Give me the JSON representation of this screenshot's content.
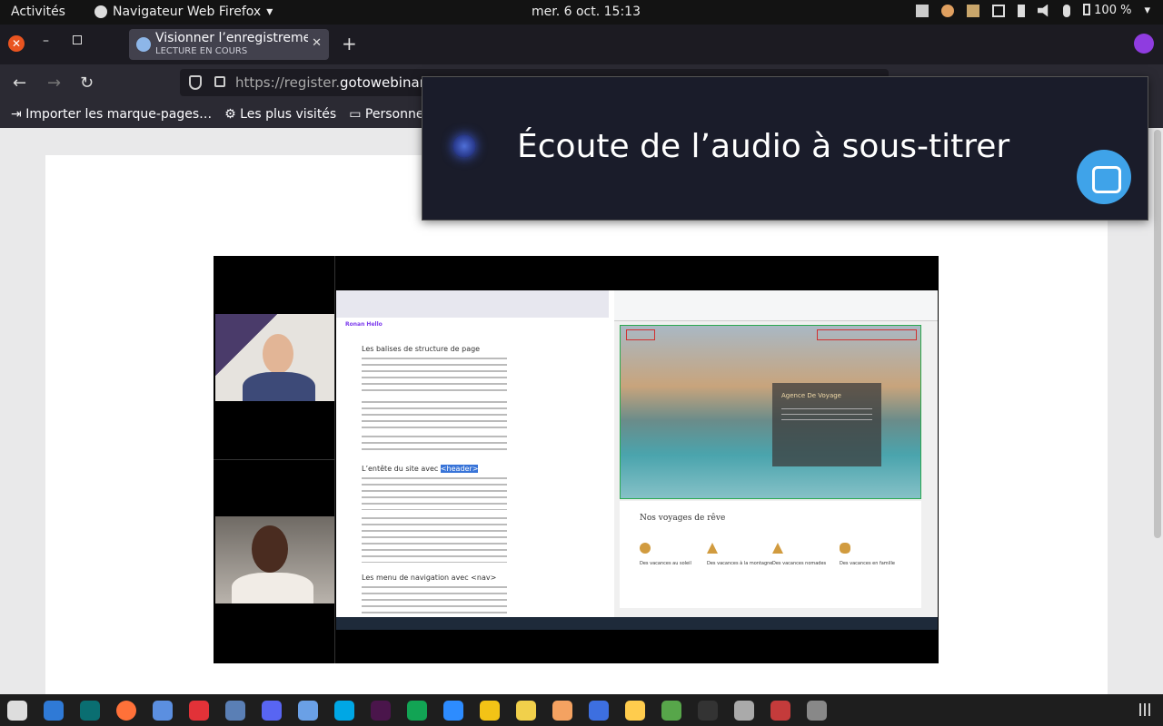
{
  "topbar": {
    "activities": "Activités",
    "app_name": "Navigateur Web Firefox",
    "clock": "mer. 6 oct.  15:13",
    "battery": "100 %"
  },
  "tab": {
    "title": "Visionner l’enregistremen",
    "subtitle": "LECTURE EN COURS"
  },
  "url": {
    "prefix": "https://register.",
    "domain": "gotowebinar."
  },
  "bookmarks": [
    "Importer les marque-pages…",
    "Les plus visités",
    "Personnel"
  ],
  "caption": {
    "text": "Écoute de l’audio à sous-titrer"
  },
  "shared": {
    "brand": "Ronan Hello",
    "h1": "Les balises de structure de page",
    "h2_prefix": "L’entête du site avec ",
    "h2_tag": "<header>",
    "h3": "Les menu de navigation avec <nav>",
    "card_title": "Agence De Voyage",
    "section_title": "Nos voyages de rêve",
    "categories": [
      "Des vacances au soleil",
      "Des vacances à la montagne",
      "Des vacances nomades",
      "Des vacances en famille"
    ]
  },
  "dock": {
    "icons": [
      "files-icon",
      "vscode-icon",
      "gitkraken-icon",
      "firefox-icon",
      "chromium-icon",
      "opera-icon",
      "browser-icon",
      "discord-icon",
      "slack-alt-icon",
      "skype-icon",
      "slack-icon",
      "git-icon",
      "zoom-icon",
      "chrome-icon",
      "notes-icon",
      "ide-icon",
      "screenshot-icon",
      "emoji-icon",
      "dev-icon",
      "terminal-icon",
      "obs-icon",
      "recorder-icon",
      "disk-icon"
    ],
    "colors": [
      "#ddd",
      "#2f7ad6",
      "#0a6e71",
      "#ff7139",
      "#5b8fe0",
      "#e23238",
      "#5a7fb5",
      "#5865f2",
      "#6aa0e6",
      "#00a7e5",
      "#4a154b",
      "#12a454",
      "#2d8cff",
      "#f3c316",
      "#f1d04b",
      "#f4a261",
      "#3d6fe0",
      "#ffcc4d",
      "#57a64a",
      "#333",
      "#aaa",
      "#c43b3b",
      "#888"
    ]
  }
}
